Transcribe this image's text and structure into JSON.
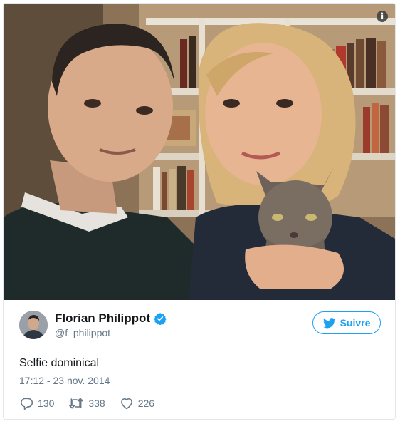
{
  "photo": {
    "info_icon": "info-icon",
    "description_icon_glyph": "i"
  },
  "author": {
    "display_name": "Florian Philippot",
    "handle": "@f_philippot",
    "verified_icon": "verified-badge-icon",
    "avatar_icon": "avatar"
  },
  "follow": {
    "label": "Suivre",
    "icon": "twitter-bird-icon"
  },
  "tweet": {
    "text": "Selfie dominical",
    "timestamp": "17:12 - 23 nov. 2014"
  },
  "actions": {
    "replies": "130",
    "retweets": "338",
    "likes": "226"
  },
  "colors": {
    "accent": "#1da1f2",
    "text": "#14171a",
    "muted": "#657786",
    "border": "#e1e8ed"
  }
}
